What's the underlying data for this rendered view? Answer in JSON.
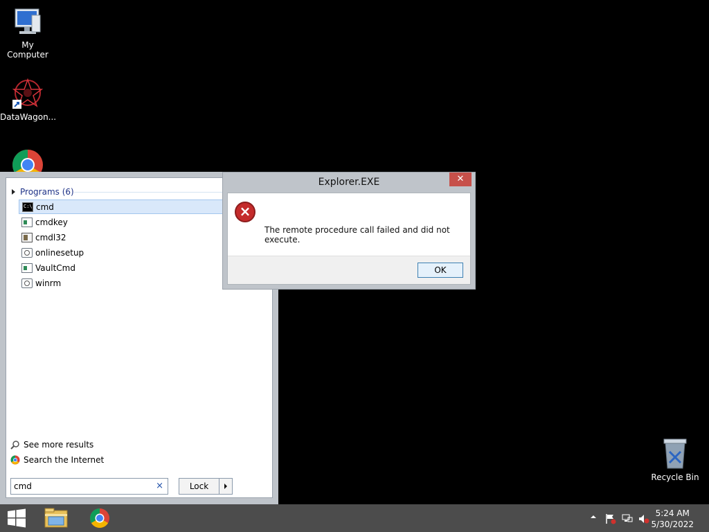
{
  "desktop": {
    "icons": [
      {
        "label": "My Computer",
        "icon": "computer-icon"
      },
      {
        "label": "DataWagon...",
        "icon": "datawagon-icon"
      },
      {
        "label": "",
        "icon": "chrome-icon"
      },
      {
        "label": "Recycle Bin",
        "icon": "recycle-bin-icon"
      }
    ]
  },
  "start_menu": {
    "group_header": "Programs (6)",
    "programs": [
      {
        "label": "cmd",
        "icon": "cmd-icon",
        "selected": true
      },
      {
        "label": "cmdkey",
        "icon": "window-app-icon"
      },
      {
        "label": "cmdl32",
        "icon": "document-app-icon"
      },
      {
        "label": "onlinesetup",
        "icon": "gear-app-icon"
      },
      {
        "label": "VaultCmd",
        "icon": "window-app-icon"
      },
      {
        "label": "winrm",
        "icon": "gear-app-icon"
      }
    ],
    "see_more": "See more results",
    "search_internet": "Search the Internet",
    "search_value": "cmd",
    "clear_glyph": "×",
    "lock_label": "Lock"
  },
  "dialog": {
    "title": "Explorer.EXE",
    "close_glyph": "✕",
    "message": "The remote procedure call failed and did not execute.",
    "ok_label": "OK",
    "icon": "error-icon"
  },
  "taskbar": {
    "clock_time": "5:24 AM",
    "clock_date": "5/30/2022",
    "tray_icons": [
      "show-hidden-icons",
      "action-center-flag-icon",
      "network-icon",
      "volume-muted-icon"
    ]
  },
  "colors": {
    "desktop": "#000000",
    "taskbar": "#4c4c4c",
    "close_button": "#c7504a",
    "selection": "#d9e8fa"
  }
}
